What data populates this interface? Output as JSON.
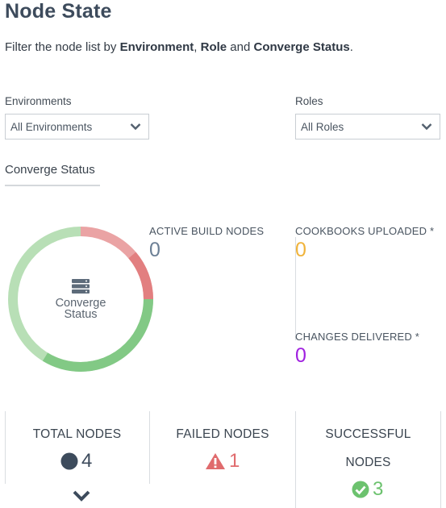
{
  "header": {
    "title": "Node State",
    "subtitle_prefix": "Filter the node list by ",
    "subtitle_env": "Environment",
    "subtitle_sep": ", ",
    "subtitle_role": "Role",
    "subtitle_and": " and ",
    "subtitle_status": "Converge Status",
    "subtitle_end": "."
  },
  "filters": {
    "environments": {
      "label": "Environments",
      "value": "All Environments"
    },
    "roles": {
      "label": "Roles",
      "value": "All Roles"
    }
  },
  "tabs": [
    {
      "label": "Converge Status",
      "active": true
    }
  ],
  "donut": {
    "line1": "Converge",
    "line2": "Status",
    "icon": "server-stack-icon",
    "segments": [
      {
        "name": "failed",
        "fraction": 0.25,
        "color": "#e27f80",
        "light_color": "#eaa3a4"
      },
      {
        "name": "successful",
        "fraction": 0.75,
        "color": "#82c985",
        "light_color": "#b8dfb6"
      }
    ]
  },
  "stats": {
    "active_build_nodes": {
      "label": "ACTIVE BUILD NODES",
      "value": "0",
      "color": "#6b7f95"
    },
    "cookbooks_uploaded": {
      "label": "COOKBOOKS UPLOADED *",
      "value": "0",
      "color": "#f0b33a"
    },
    "changes_delivered": {
      "label": "CHANGES DELIVERED *",
      "value": "0",
      "color": "#a020e0"
    }
  },
  "cards": {
    "total": {
      "title": "TOTAL NODES",
      "value": "4",
      "icon": "dot-icon",
      "color": "#3d4b5c"
    },
    "failed": {
      "title": "FAILED NODES",
      "value": "1",
      "icon": "warning-icon",
      "color": "#e06b6d"
    },
    "successful": {
      "title_line1": "SUCCESSFUL",
      "title_line2": "NODES",
      "value": "3",
      "icon": "check-circle-icon",
      "color": "#6cc26e"
    }
  },
  "expand": {
    "icon": "chevron-down-icon"
  }
}
